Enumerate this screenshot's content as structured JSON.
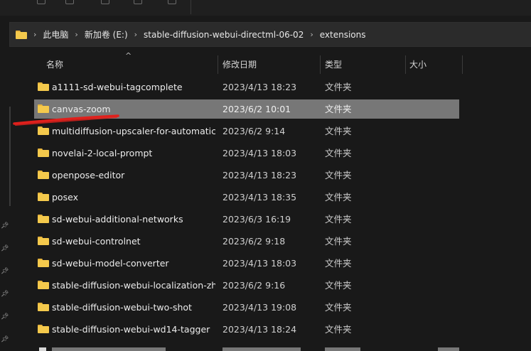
{
  "address_bar": {
    "crumbs": [
      "此电脑",
      "新加卷 (E:)",
      "stable-diffusion-webui-directml-06-02",
      "extensions"
    ]
  },
  "columns": {
    "name": "名称",
    "modified": "修改日期",
    "type": "类型",
    "size": "大小"
  },
  "files": [
    {
      "name": "a1111-sd-webui-tagcomplete",
      "modified": "2023/4/13 18:23",
      "type": "文件夹"
    },
    {
      "name": "canvas-zoom",
      "modified": "2023/6/2 10:01",
      "type": "文件夹"
    },
    {
      "name": "multidiffusion-upscaler-for-automatic...",
      "modified": "2023/6/2 9:14",
      "type": "文件夹"
    },
    {
      "name": "novelai-2-local-prompt",
      "modified": "2023/4/13 18:03",
      "type": "文件夹"
    },
    {
      "name": "openpose-editor",
      "modified": "2023/4/13 18:23",
      "type": "文件夹"
    },
    {
      "name": "posex",
      "modified": "2023/4/13 18:35",
      "type": "文件夹"
    },
    {
      "name": "sd-webui-additional-networks",
      "modified": "2023/6/3 16:19",
      "type": "文件夹"
    },
    {
      "name": "sd-webui-controlnet",
      "modified": "2023/6/2 9:18",
      "type": "文件夹"
    },
    {
      "name": "sd-webui-model-converter",
      "modified": "2023/4/13 18:03",
      "type": "文件夹"
    },
    {
      "name": "stable-diffusion-webui-localization-zh...",
      "modified": "2023/6/2 9:16",
      "type": "文件夹"
    },
    {
      "name": "stable-diffusion-webui-two-shot",
      "modified": "2023/4/13 19:08",
      "type": "文件夹"
    },
    {
      "name": "stable-diffusion-webui-wd14-tagger",
      "modified": "2023/4/13 18:24",
      "type": "文件夹"
    }
  ],
  "selected_index": 1,
  "icons": {
    "folder": "folder-icon",
    "pin": "pin-icon",
    "chevron": "chevron-right-icon",
    "sort": "sort-up-icon"
  },
  "colors": {
    "background": "#191919",
    "selection": "#777777",
    "folder": "#f4c94c",
    "annotation_stroke": "#e0201c"
  }
}
